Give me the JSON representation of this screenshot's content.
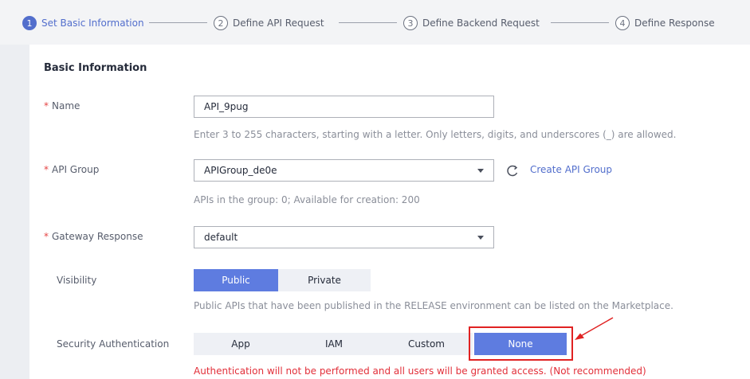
{
  "steps": [
    {
      "number": "1",
      "label": "Set Basic Information",
      "active": true
    },
    {
      "number": "2",
      "label": "Define API Request",
      "active": false
    },
    {
      "number": "3",
      "label": "Define Backend Request",
      "active": false
    },
    {
      "number": "4",
      "label": "Define Response",
      "active": false
    }
  ],
  "section_title": "Basic Information",
  "form": {
    "name": {
      "label": "Name",
      "required": "*",
      "value": "API_9pug",
      "hint": "Enter 3 to 255 characters, starting with a letter. Only letters, digits, and underscores (_) are allowed."
    },
    "api_group": {
      "label": "API Group",
      "required": "*",
      "value": "APIGroup_de0e",
      "refresh_icon": "refresh-icon",
      "create_link": "Create API Group",
      "hint": "APIs in the group: 0; Available for creation: 200"
    },
    "gateway_response": {
      "label": "Gateway Response",
      "required": "*",
      "value": "default"
    },
    "visibility": {
      "label": "Visibility",
      "options": [
        "Public",
        "Private"
      ],
      "selected": "Public",
      "hint": "Public APIs that have been published in the RELEASE environment can be listed on the Marketplace."
    },
    "security_authentication": {
      "label": "Security Authentication",
      "options": [
        "App",
        "IAM",
        "Custom",
        "None"
      ],
      "selected": "None",
      "warning": "Authentication will not be performed and all users will be granted access. (Not recommended)"
    }
  },
  "colors": {
    "accent": "#526ecc",
    "segment_selected": "#5e7ce0",
    "required": "#e54545",
    "warning": "#e2303a",
    "annotation": "#e02222"
  }
}
